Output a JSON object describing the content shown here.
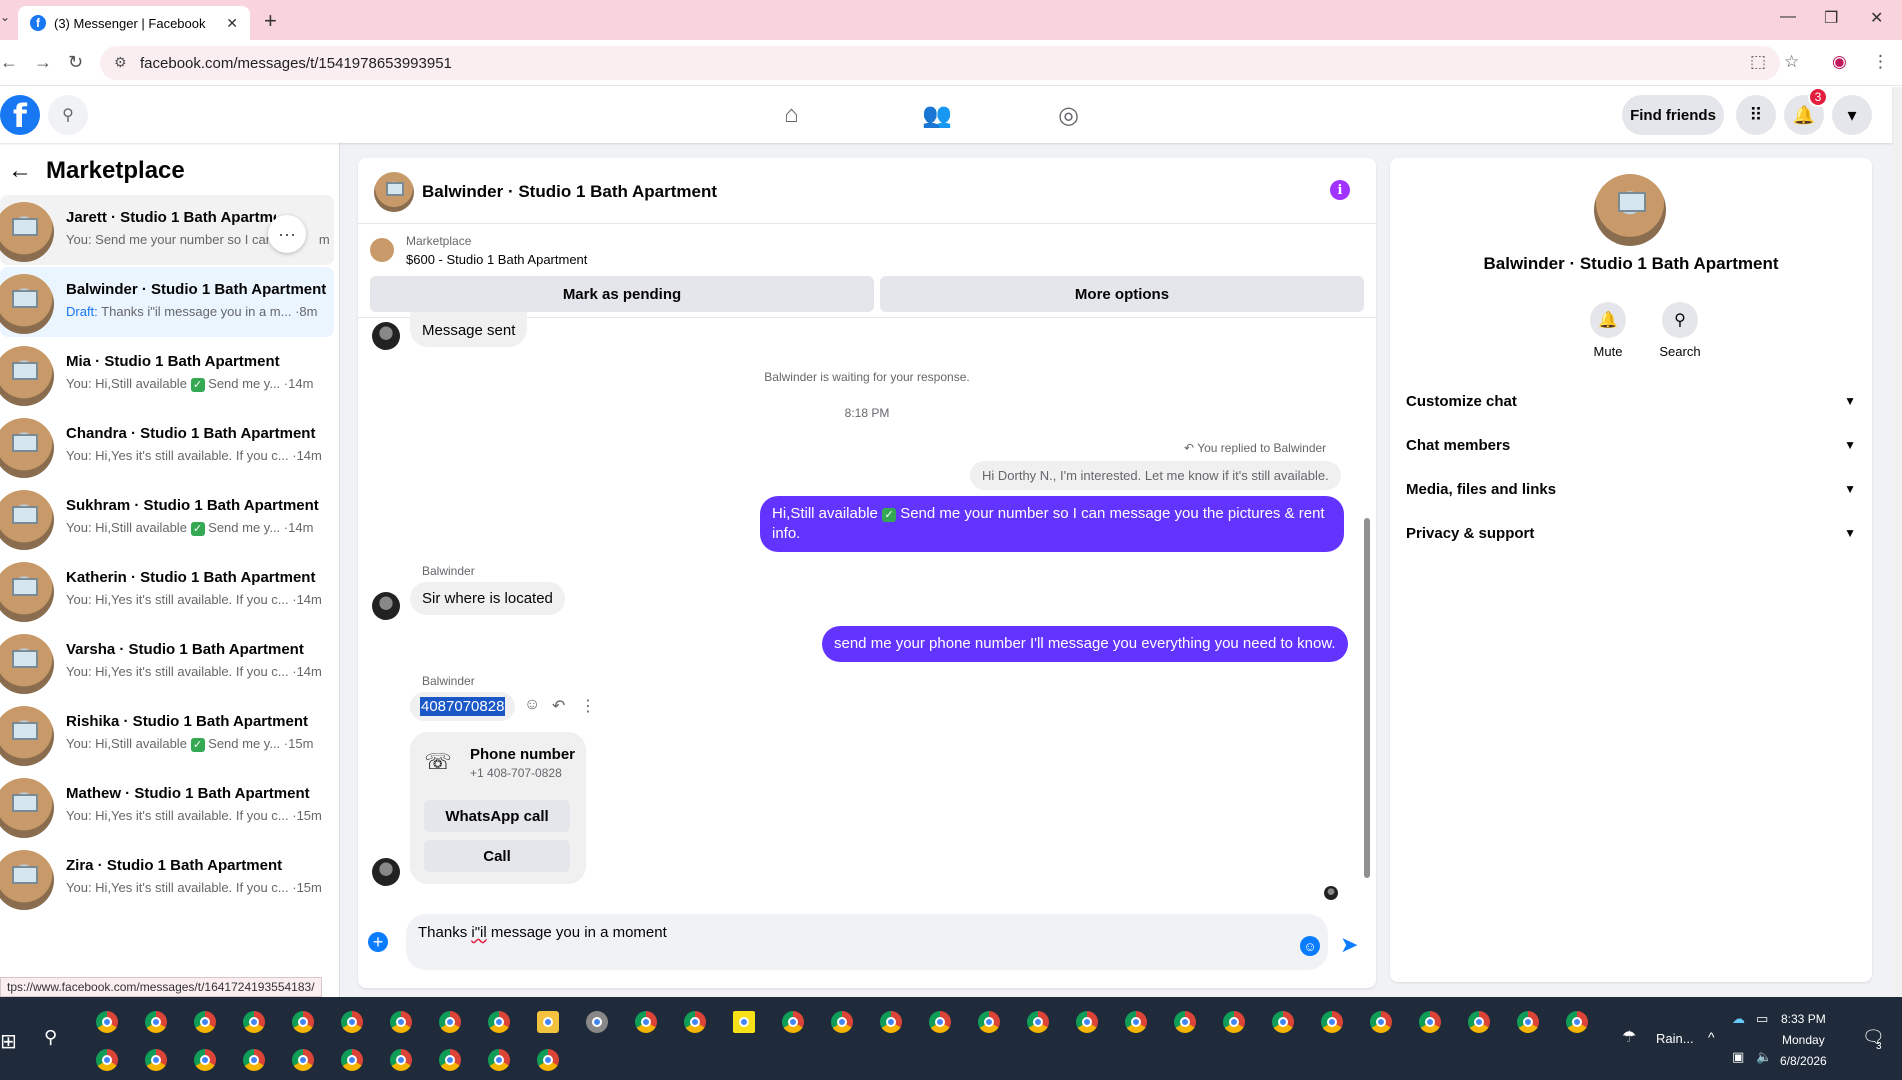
{
  "browser": {
    "tab_title": "(3) Messenger | Facebook",
    "url": "facebook.com/messages/t/1541978653993951",
    "status_url": "tps://www.facebook.com/messages/t/1641724193554183/"
  },
  "header": {
    "find_friends": "Find friends",
    "notification_count": "3"
  },
  "sidebar": {
    "title": "Marketplace",
    "conversations": [
      {
        "name": "Jarett · Studio 1 Bath Apartment",
        "preview": "You: Send me your number so I can",
        "time": "m",
        "state": "hover"
      },
      {
        "name": "Balwinder · Studio 1 Bath Apartment",
        "draft": "Draft:",
        "preview": " Thanks i\"il message you in a m... ·8m",
        "state": "active"
      },
      {
        "name": "Mia · Studio 1 Bath Apartment",
        "preview_a": "You: Hi,Still available ",
        "preview_b": " Send me y... ·14m"
      },
      {
        "name": "Chandra · Studio 1 Bath Apartment",
        "preview": "You: Hi,Yes it's still available. If you c... ·14m"
      },
      {
        "name": "Sukhram · Studio 1 Bath Apartment",
        "preview_a": "You: Hi,Still available ",
        "preview_b": " Send me y... ·14m"
      },
      {
        "name": "Katherin · Studio 1 Bath Apartment",
        "preview": "You: Hi,Yes it's still available. If you c... ·14m"
      },
      {
        "name": "Varsha · Studio 1 Bath Apartment",
        "preview": "You: Hi,Yes it's still available. If you c... ·14m"
      },
      {
        "name": "Rishika · Studio 1 Bath Apartment",
        "preview_a": "You: Hi,Still available ",
        "preview_b": " Send me y... ·15m"
      },
      {
        "name": "Mathew · Studio 1 Bath Apartment",
        "preview": "You: Hi,Yes it's still available. If you c... ·15m"
      },
      {
        "name": "Zira · Studio 1 Bath Apartment",
        "preview": "You: Hi,Yes it's still available. If you c... ·15m"
      }
    ]
  },
  "chat": {
    "title": "Balwinder · Studio 1 Bath Apartment",
    "marketplace_label": "Marketplace",
    "listing": "$600 - Studio 1 Bath Apartment",
    "mark_pending": "Mark as pending",
    "more_options": "More options",
    "messages": {
      "message_sent": "Message sent",
      "waiting": "Balwinder is waiting for your response.",
      "time": "8:18 PM",
      "replied": "You replied to Balwinder",
      "quote": "Hi Dorthy N., I'm interested. Let me know if it's still available.",
      "out1_a": "Hi,Still available ",
      "out1_b": " Send me your number so I can message you the pictures & rent info.",
      "sender1": "Balwinder",
      "in1": "Sir where is located",
      "out2": "send me your phone number I'll message you everything you need to know.",
      "sender2": "Balwinder",
      "phone": "4087070828",
      "card_title": "Phone number",
      "card_number": "+1 408-707-0828",
      "whatsapp": "WhatsApp call",
      "call": "Call"
    },
    "composer_a": "Thanks ",
    "composer_b": "i\"il",
    "composer_c": " message you in a moment"
  },
  "info": {
    "name": "Balwinder · Studio 1 Bath Apartment",
    "mute": "Mute",
    "search": "Search",
    "rows": [
      "Customize chat",
      "Chat members",
      "Media, files and links",
      "Privacy & support"
    ]
  },
  "taskbar": {
    "weather": "Rain...",
    "time": "8:33 PM",
    "day": "Monday",
    "date": "6/8/2026",
    "notif_count": "3"
  },
  "colors": {
    "accent": "#6333ff",
    "fb_blue": "#1877f2",
    "check_green": "#34a853"
  }
}
